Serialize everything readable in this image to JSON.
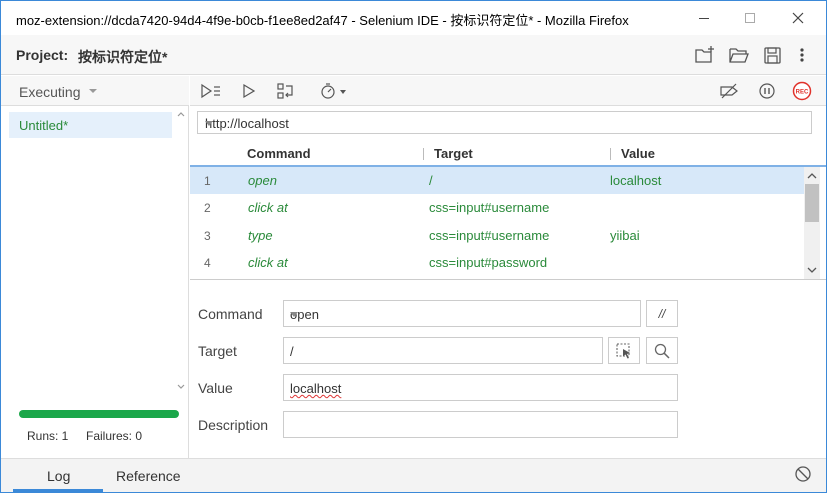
{
  "window": {
    "title": "moz-extension://dcda7420-94d4-4f9e-b0cb-f1ee8ed2af47 - Selenium IDE - 按标识符定位* - Mozilla Firefox"
  },
  "project": {
    "label": "Project:",
    "name": "按标识符定位*"
  },
  "sidebar": {
    "dropdown_label": "Executing",
    "items": [
      {
        "label": "Untitled*"
      }
    ],
    "runs_label": "Runs: 1",
    "failures_label": "Failures: 0",
    "progress_fraction": 1.0,
    "progress_color": "#1ba74a"
  },
  "url": {
    "value": "http://localhost"
  },
  "table": {
    "headers": [
      "Command",
      "Target",
      "Value"
    ],
    "rows": [
      {
        "num": "1",
        "command": "open",
        "target": "/",
        "value": "localhost"
      },
      {
        "num": "2",
        "command": "click at",
        "target": "css=input#username",
        "value": ""
      },
      {
        "num": "3",
        "command": "type",
        "target": "css=input#username",
        "value": "yiibai"
      },
      {
        "num": "4",
        "command": "click at",
        "target": "css=input#password",
        "value": ""
      }
    ]
  },
  "editor": {
    "command_label": "Command",
    "command_value": "open",
    "comment_button": "//",
    "target_label": "Target",
    "target_value": "/",
    "value_label": "Value",
    "value_value": "localhost",
    "description_label": "Description",
    "description_value": ""
  },
  "bottom_tabs": [
    {
      "label": "Log",
      "active": true
    },
    {
      "label": "Reference",
      "active": false
    }
  ],
  "colors": {
    "accent": "#3b89d8",
    "command_green": "#2a8a3a",
    "rec_red": "#e0322b",
    "selected_row": "#d7e8f9"
  },
  "icons": {
    "run_all": "run-all-tests-icon",
    "run": "run-current-test-icon",
    "step": "step-over-icon",
    "speed": "test-speed-icon",
    "disable_breakpoints": "disable-breakpoints-icon",
    "pause": "pause-on-exceptions-icon",
    "record": "record-icon"
  }
}
